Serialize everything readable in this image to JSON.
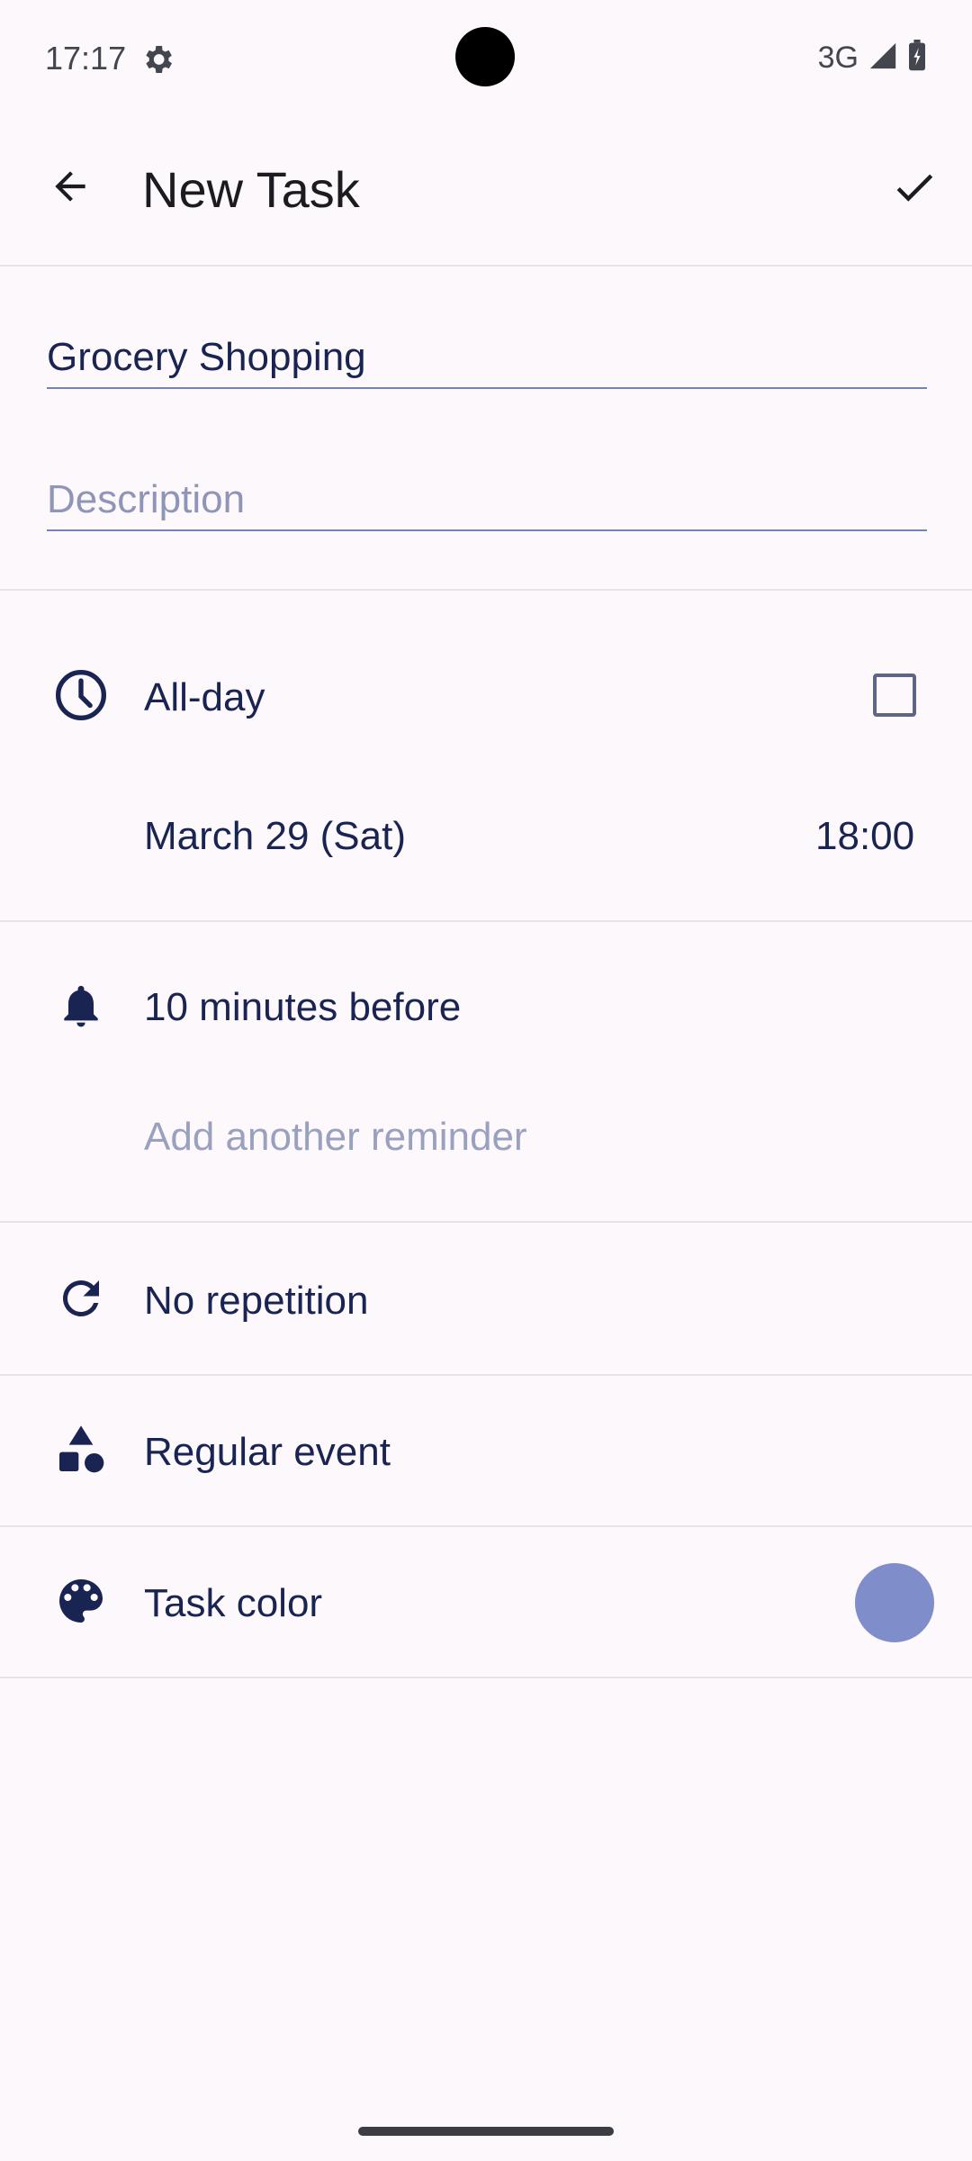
{
  "status": {
    "time": "17:17",
    "network": "3G"
  },
  "appbar": {
    "title": "New Task",
    "back_icon": "arrow-back-icon",
    "save_icon": "check-icon"
  },
  "form": {
    "title_value": "Grocery Shopping",
    "description_placeholder": "Description"
  },
  "schedule": {
    "allday_label": "All-day",
    "allday_checked": false,
    "date": "March 29 (Sat)",
    "time": "18:00"
  },
  "reminders": {
    "current": "10 minutes before",
    "add_placeholder": "Add another reminder"
  },
  "repetition": {
    "label": "No repetition"
  },
  "event_type": {
    "label": "Regular event"
  },
  "color": {
    "label": "Task color",
    "value": "#7f8ecb"
  },
  "icons": [
    "clock-icon",
    "bell-icon",
    "repeat-icon",
    "shapes-icon",
    "palette-icon"
  ]
}
